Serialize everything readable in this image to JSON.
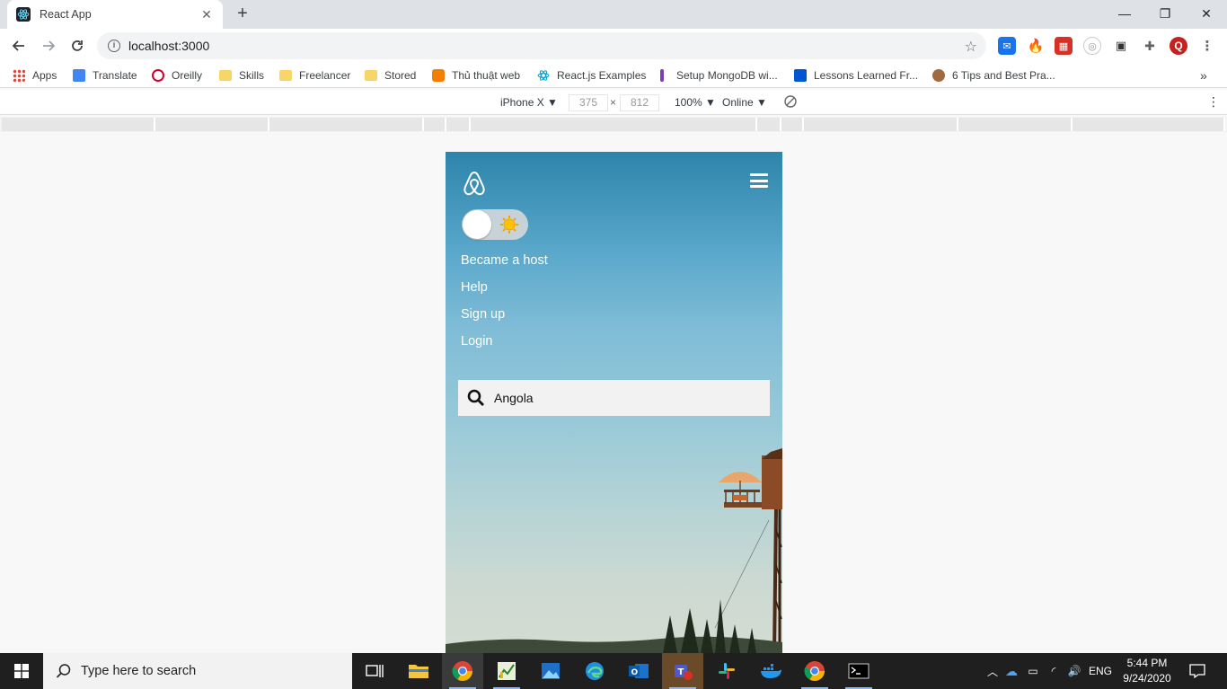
{
  "browser": {
    "tab_title": "React App",
    "new_tab": "+",
    "url": "localhost:3000",
    "profile_initial": "Q",
    "window_controls": {
      "minimize": "—",
      "restore": "❐",
      "close": "✕"
    }
  },
  "bookmarks": {
    "apps_label": "Apps",
    "items": [
      {
        "label": "Translate",
        "icon": "translate-icon"
      },
      {
        "label": "Oreilly",
        "icon": "oreilly-icon"
      },
      {
        "label": "Skills",
        "icon": "folder-icon"
      },
      {
        "label": "Freelancer",
        "icon": "folder-icon"
      },
      {
        "label": "Stored",
        "icon": "folder-icon"
      },
      {
        "label": "Thủ thuật web",
        "icon": "blogger-icon"
      },
      {
        "label": "React.js Examples",
        "icon": "react-icon"
      },
      {
        "label": "Setup MongoDB wi...",
        "icon": "mongodb-icon"
      },
      {
        "label": "Lessons Learned Fr...",
        "icon": "coursera-icon"
      },
      {
        "label": "6 Tips and Best Pra...",
        "icon": "dog-icon"
      }
    ],
    "overflow": "»"
  },
  "devtools": {
    "device": "iPhone X ▼",
    "width": "375",
    "times": "×",
    "height": "812",
    "zoom": "100% ▼",
    "network": "Online ▼"
  },
  "app": {
    "menu": [
      "Became a host",
      "Help",
      "Sign up",
      "Login"
    ],
    "search_value": "Angola",
    "theme_toggle_on": false
  },
  "taskbar": {
    "search_placeholder": "Type here to search",
    "language": "ENG",
    "time": "5:44 PM",
    "date": "9/24/2020"
  },
  "colors": {
    "sky_top": "#2d84ab",
    "sky_bottom": "#d4dcd2",
    "search_bg": "#f2f2f2",
    "taskbar_bg": "#1f1f1f",
    "profile": "#c5221f"
  }
}
